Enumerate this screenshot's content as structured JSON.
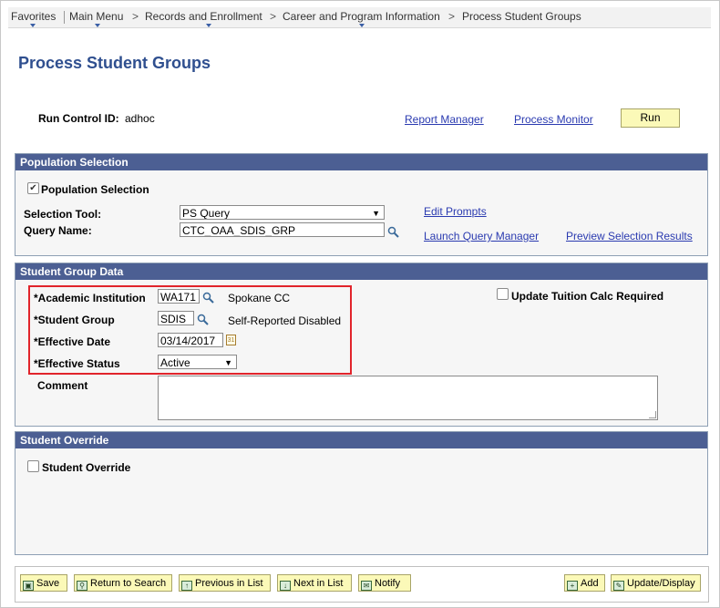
{
  "breadcrumb": {
    "items": [
      "Favorites",
      "Main Menu",
      "Records and Enrollment",
      "Career and Program Information",
      "Process Student Groups"
    ]
  },
  "page": {
    "title": "Process Student Groups"
  },
  "run_control": {
    "label": "Run Control ID:",
    "value": "adhoc",
    "report_manager": "Report Manager",
    "process_monitor": "Process Monitor",
    "run_button": "Run"
  },
  "population_selection": {
    "header": "Population Selection",
    "checkbox_label": "Population Selection",
    "checkbox_checked": true,
    "selection_tool_label": "Selection Tool:",
    "selection_tool_value": "PS Query",
    "query_name_label": "Query Name:",
    "query_name_value": "CTC_OAA_SDIS_GRP",
    "edit_prompts": "Edit Prompts",
    "launch_query_manager": "Launch Query Manager",
    "preview_results": "Preview Selection Results"
  },
  "student_group_data": {
    "header": "Student Group Data",
    "academic_institution_label": "*Academic Institution",
    "academic_institution_value": "WA171",
    "academic_institution_desc": "Spokane CC",
    "student_group_label": "*Student Group",
    "student_group_value": "SDIS",
    "student_group_desc": "Self-Reported Disabled",
    "effective_date_label": "*Effective Date",
    "effective_date_value": "03/14/2017",
    "effective_status_label": "*Effective Status",
    "effective_status_value": "Active",
    "update_tuition_label": "Update Tuition Calc Required",
    "update_tuition_checked": false,
    "comment_label": "Comment",
    "comment_value": ""
  },
  "student_override": {
    "header": "Student Override",
    "checkbox_label": "Student Override",
    "checkbox_checked": false
  },
  "toolbar": {
    "save": "Save",
    "return_to_search": "Return to Search",
    "previous_in_list": "Previous in List",
    "next_in_list": "Next in List",
    "notify": "Notify",
    "add": "Add",
    "update_display": "Update/Display"
  },
  "colors": {
    "section_header_bg": "#4c5f93",
    "title_color": "#2f4f8f",
    "link_color": "#2a3ab0",
    "button_bg": "#fbf9b8",
    "highlight_border": "#e1242b"
  }
}
